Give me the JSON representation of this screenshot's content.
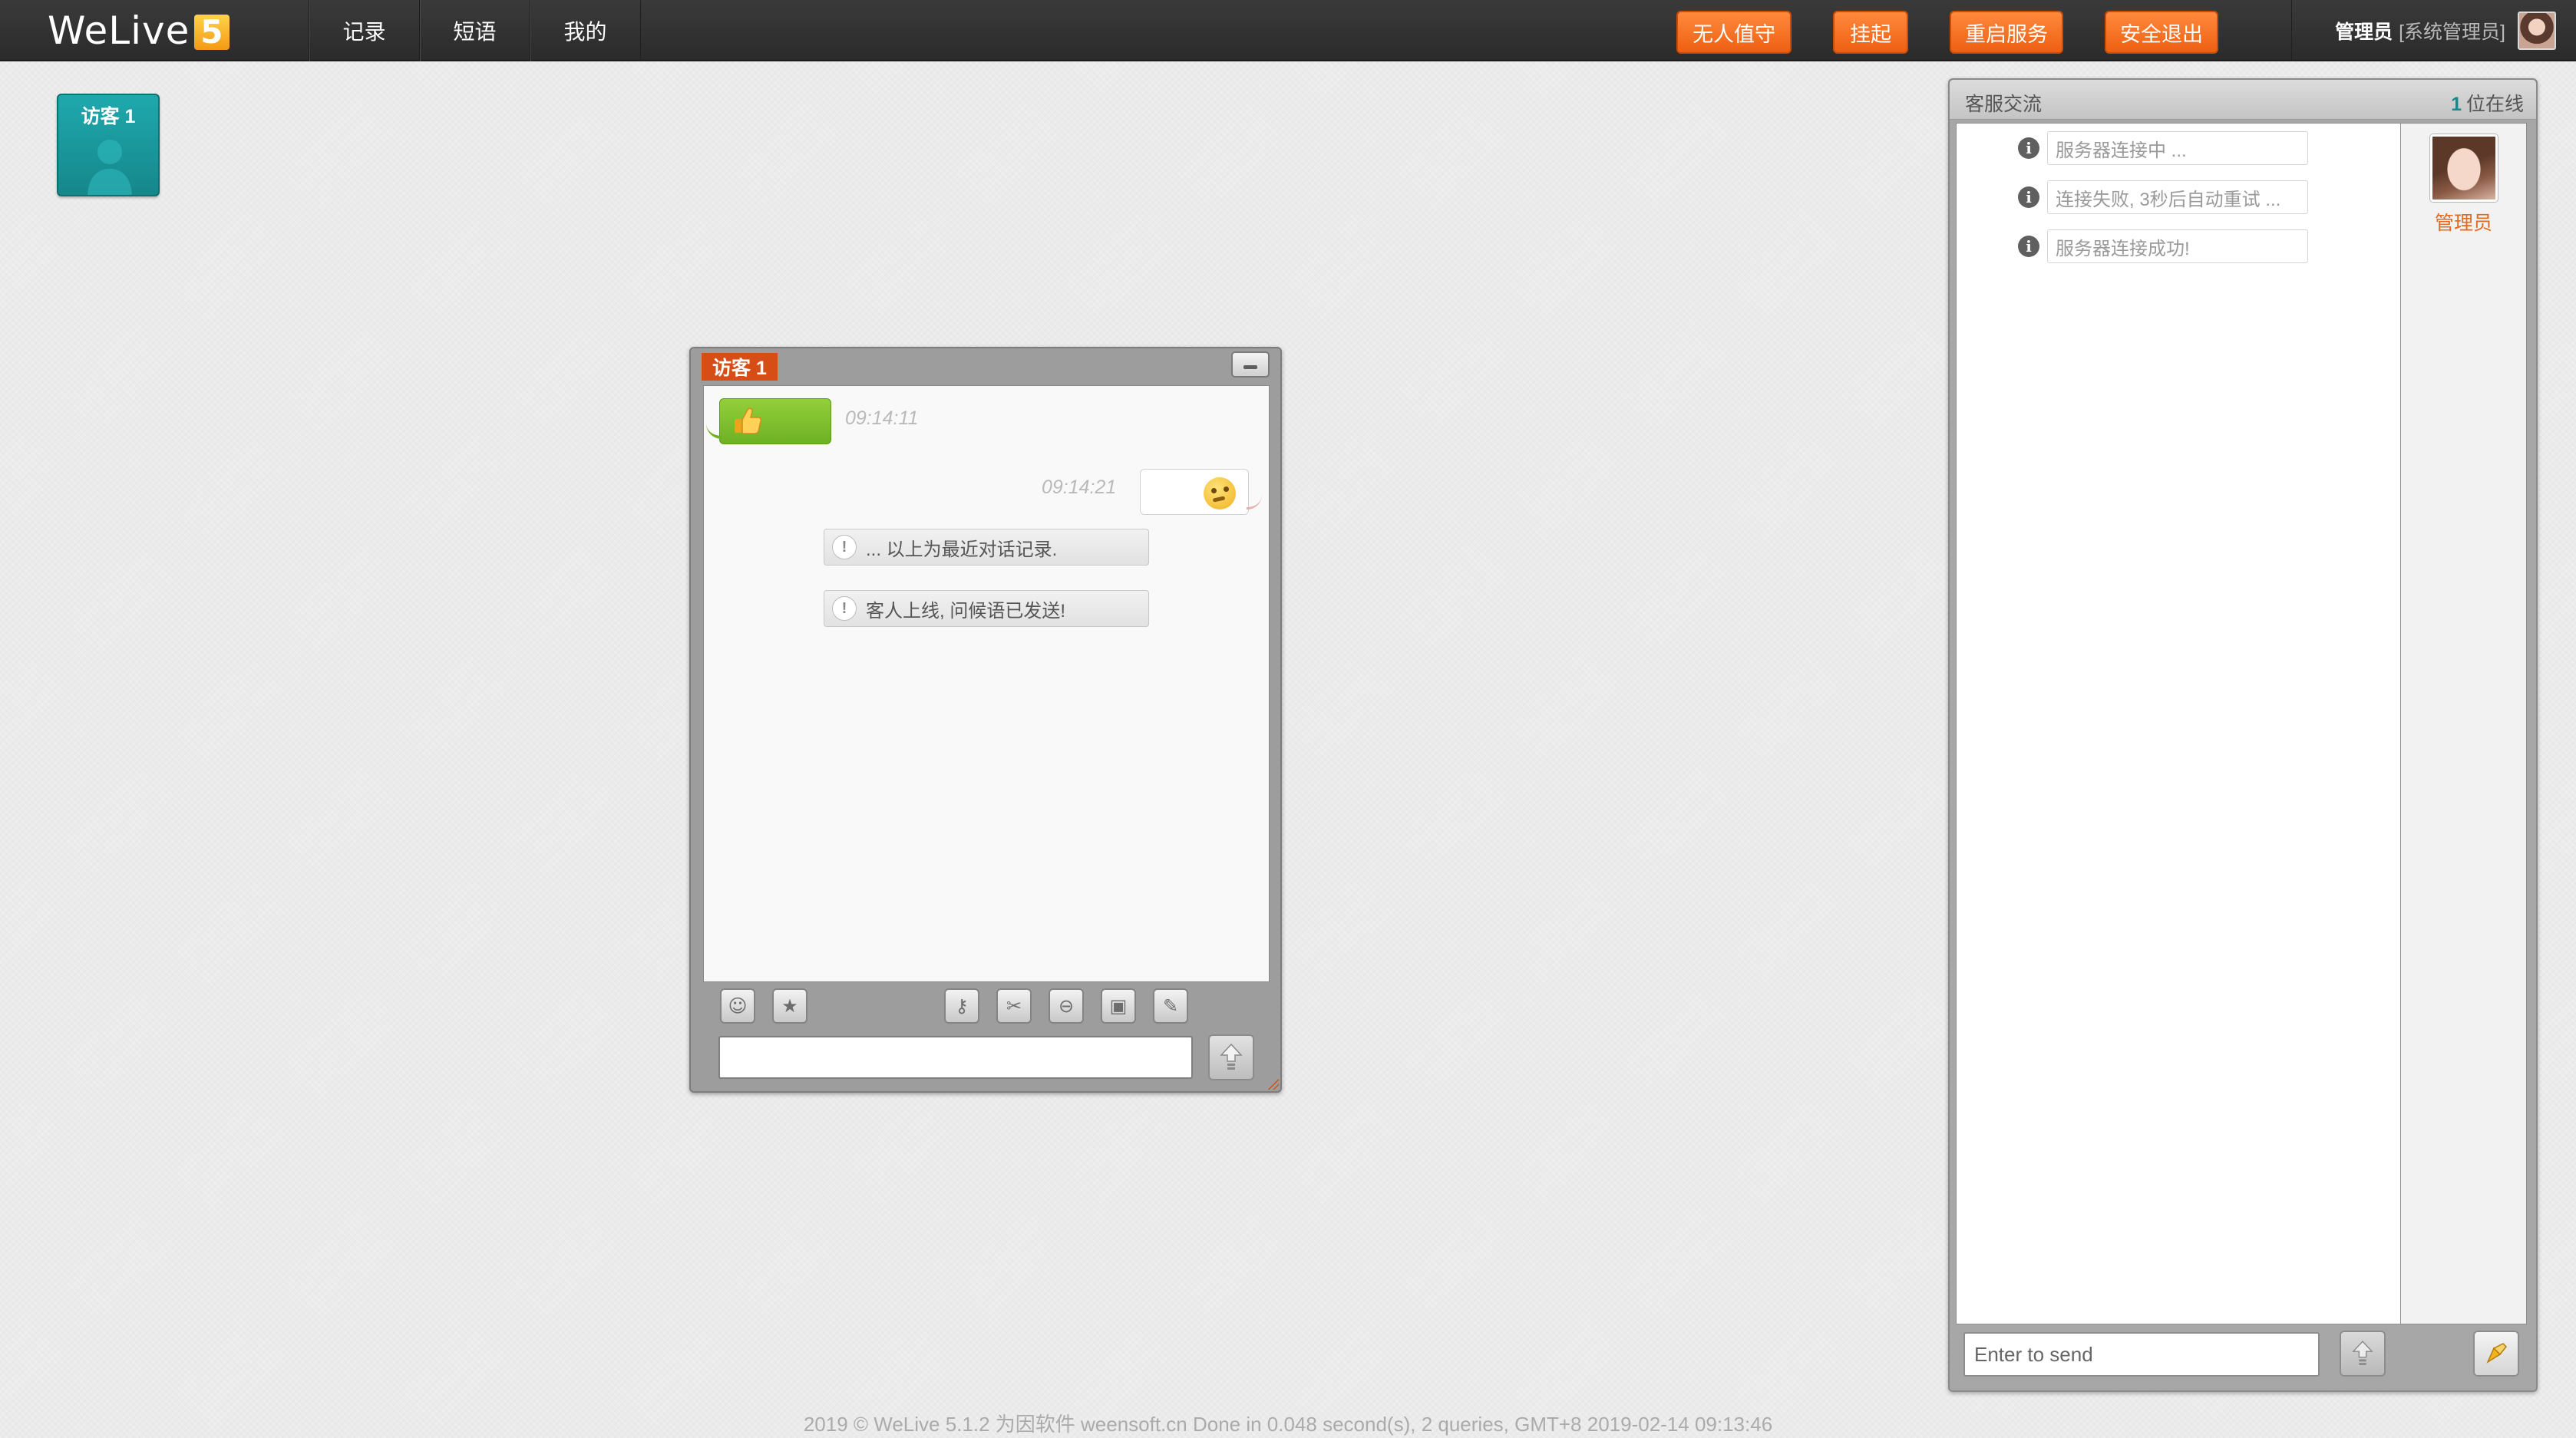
{
  "app": {
    "logo_text": "WeLive",
    "logo_badge": "5"
  },
  "nav": {
    "items": [
      {
        "label": "记录"
      },
      {
        "label": "短语"
      },
      {
        "label": "我的"
      }
    ]
  },
  "actions": {
    "unattended": "无人值守",
    "suspend": "挂起",
    "restart": "重启服务",
    "logout": "安全退出"
  },
  "user": {
    "name": "管理员",
    "role": "[系统管理员]",
    "avatar_icon": "user-avatar-icon"
  },
  "visitor_card": {
    "label": "访客 1",
    "icon": "person-silhouette-icon"
  },
  "chat_window": {
    "title": "访客 1",
    "messages": [
      {
        "side": "left",
        "content_icon": "thumbs-up-icon",
        "time": "09:14:11"
      },
      {
        "side": "right",
        "content_icon": "thinking-face-icon",
        "time": "09:14:21"
      }
    ],
    "system_notes": [
      "... 以上为最近对话记录.",
      "客人上线, 问候语已发送!"
    ],
    "toolbar_icons": [
      "smiley-icon",
      "star-icon",
      "key-icon",
      "scissors-icon",
      "block-icon",
      "camera-icon",
      "brush-icon"
    ],
    "input_value": "",
    "send_icon": "send-arrow-icon"
  },
  "right_panel": {
    "title": "客服交流",
    "online_count": "1",
    "online_suffix": "位在线",
    "server_messages": [
      "服务器连接中 ...",
      "连接失败, 3秒后自动重试 ...",
      "服务器连接成功!"
    ],
    "admin": {
      "label": "管理员"
    },
    "input_placeholder": "Enter to send"
  },
  "footer": {
    "text": "2019 © WeLive 5.1.2 为因软件 weensoft.cn Done in 0.048 second(s), 2 queries, GMT+8 2019-02-14 09:13:46"
  },
  "colors": {
    "topbar": "#2f2f2f",
    "accent_orange": "#f06a1e",
    "visitor_teal": "#1a9ea2",
    "bubble_green": "#7dbd2a"
  }
}
